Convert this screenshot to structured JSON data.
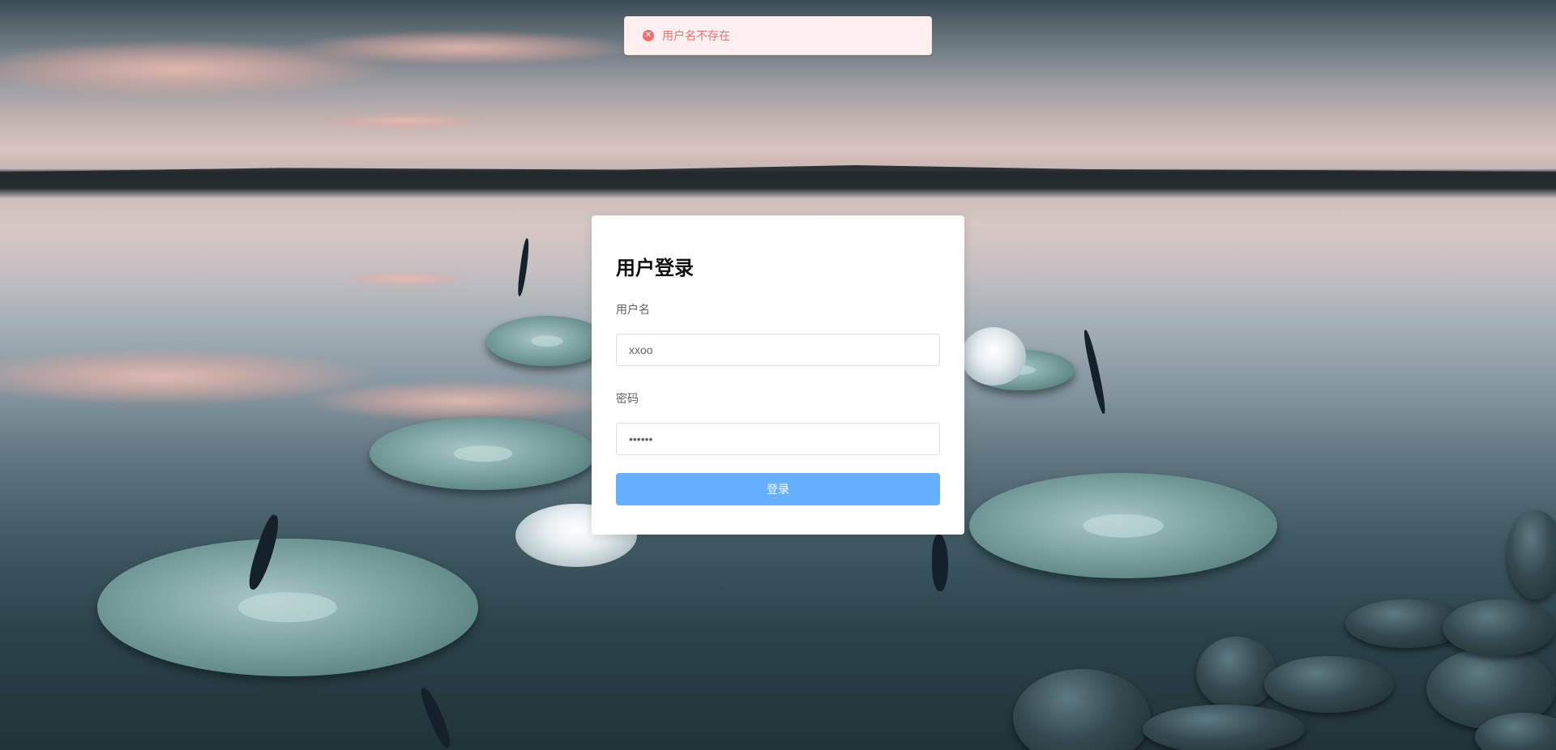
{
  "message": {
    "type": "error",
    "text": "用户名不存在",
    "icon": "error-circle-icon",
    "color": "#f56c6c",
    "background": "#fef0f0"
  },
  "login": {
    "title": "用户登录",
    "username_label": "用户名",
    "username_value": "xxoo",
    "password_label": "密码",
    "password_value": "••••••",
    "submit_label": "登录",
    "submit_color": "#66b1ff"
  }
}
